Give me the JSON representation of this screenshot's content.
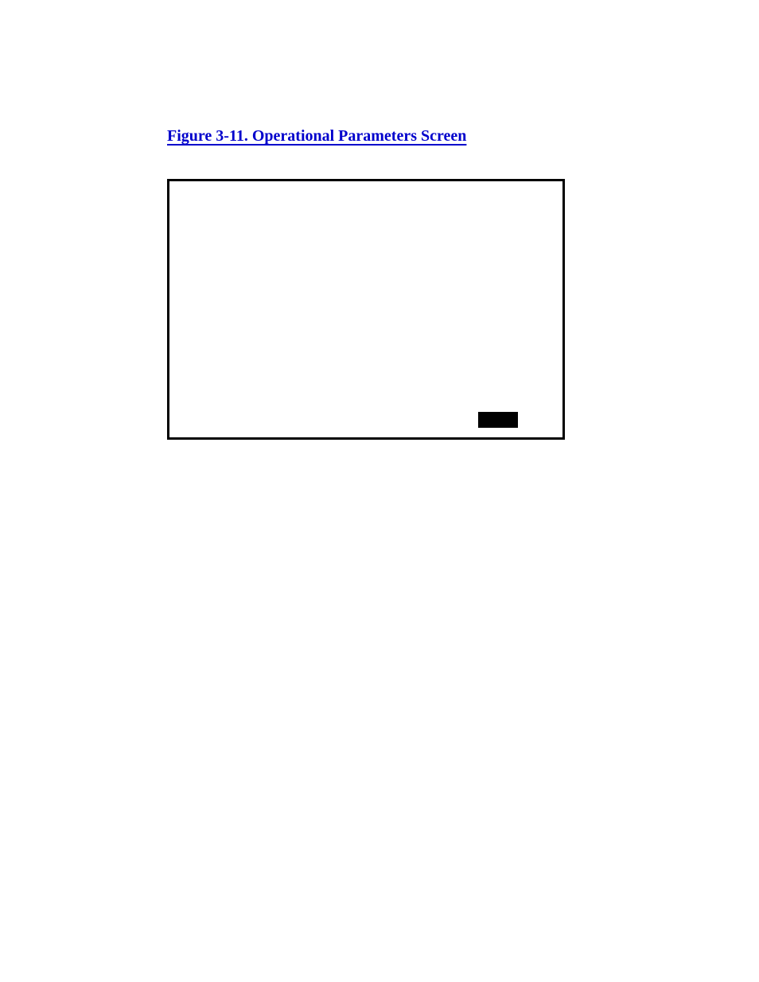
{
  "heading": {
    "text": "Figure 3-11. Operational Parameters Screen"
  }
}
